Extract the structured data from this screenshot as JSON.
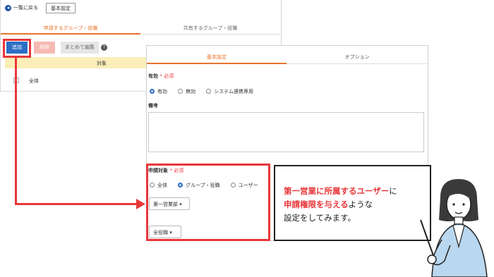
{
  "back_screen": {
    "back_link": "一覧に戻る",
    "basic_settings_button": "基本設定",
    "tabs": [
      "申請するグループ・役職",
      "共有するグループ・役職"
    ],
    "add_button": "追加",
    "delete_button": "削除",
    "bulk_edit_button": "まとめて編集",
    "help_icon": "?",
    "table_header": "対象",
    "row_value": "全体"
  },
  "front_screen": {
    "tabs": [
      "基本設定",
      "オプション"
    ],
    "valid_label": "有効",
    "required_mark": "* 必須",
    "valid_options": [
      "有効",
      "無効",
      "システム連携専用"
    ],
    "notes_label": "備考",
    "target_label": "申請対象",
    "target_options": [
      "全体",
      "グループ・役職",
      "ユーザー"
    ],
    "group_select": "第一営業部",
    "role_select": "全役職"
  },
  "callout": {
    "line1_hl": "第一営業に所属するユーザー",
    "line1_rest": "に",
    "line2_hl": "申請権限を与える",
    "line2_rest": "ような",
    "line3": "設定をしてみます。"
  },
  "colors": {
    "accent": "#e8373a",
    "tab_orange": "#e8732c",
    "primary_blue": "#2d6fc4"
  },
  "icons": [
    "back-arrow-icon",
    "help-icon",
    "dropdown-caret-icon"
  ]
}
